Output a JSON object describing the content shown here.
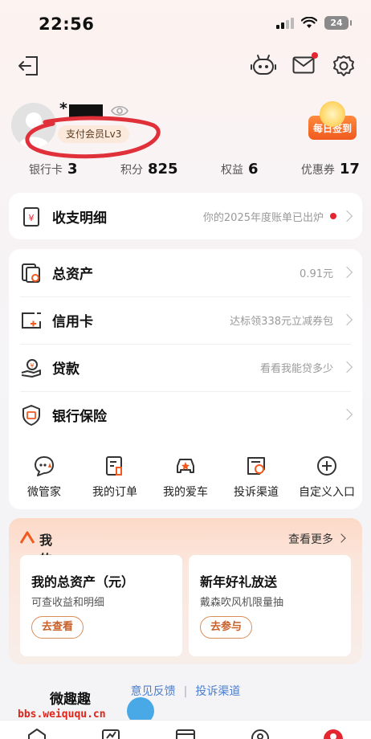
{
  "status_bar": {
    "time": "22:56",
    "battery": "24"
  },
  "profile": {
    "name_visible": "*",
    "level_badge": "支付会员Lv3",
    "checkin_label": "每日签到"
  },
  "stats": [
    {
      "label": "银行卡",
      "value": "3"
    },
    {
      "label": "积分",
      "value": "825"
    },
    {
      "label": "权益",
      "value": "6"
    },
    {
      "label": "优惠券",
      "value": "17"
    }
  ],
  "bill": {
    "title": "收支明细",
    "hint": "你的2025年度账单已出炉"
  },
  "menu": [
    {
      "title": "总资产",
      "hint": "0.91元"
    },
    {
      "title": "信用卡",
      "hint": "达标领338元立减券包"
    },
    {
      "title": "贷款",
      "hint": "看看我能贷多少"
    },
    {
      "title": "银行保险",
      "hint": ""
    }
  ],
  "quick_links": [
    {
      "label": "微管家"
    },
    {
      "label": "我的订单"
    },
    {
      "label": "我的爱车"
    },
    {
      "label": "投诉渠道"
    },
    {
      "label": "自定义入口"
    }
  ],
  "my_pingan": {
    "title": "我的平安",
    "more": "查看更多",
    "cards": [
      {
        "title": "我的总资产（元）",
        "subtitle": "可查收益和明细",
        "button": "去查看"
      },
      {
        "title": "新年好礼放送",
        "subtitle": "戴森吹风机限量抽",
        "button": "去参与"
      }
    ]
  },
  "footer": {
    "feedback": "意见反馈",
    "complaint": "投诉渠道"
  },
  "watermark": {
    "line1": "微趣趣",
    "line2": "bbs.weiququ.cn"
  },
  "colors": {
    "accent": "#e5252f",
    "orange": "#f05a1e",
    "link": "#4d7fd0"
  }
}
